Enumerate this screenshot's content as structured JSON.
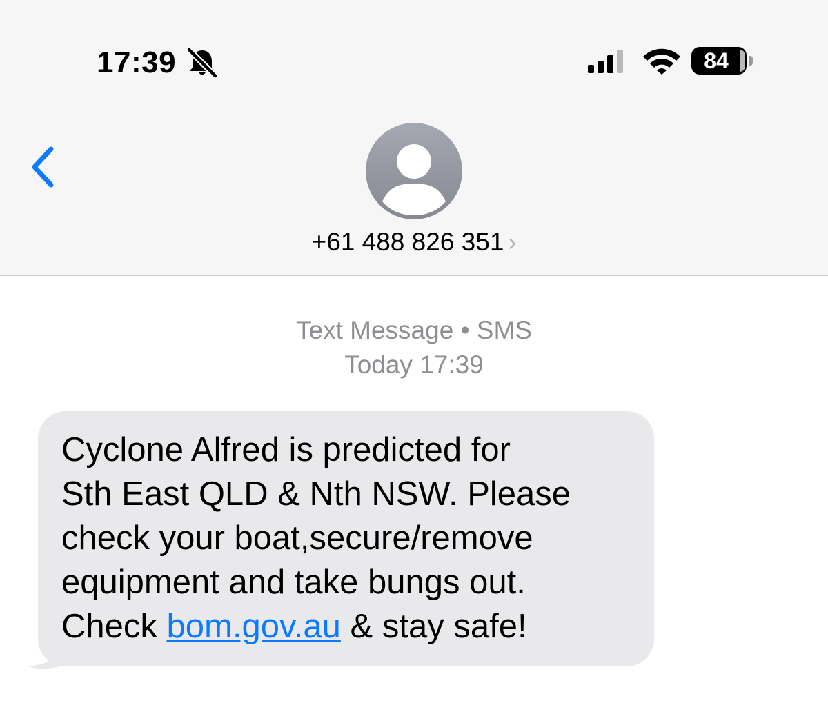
{
  "status_bar": {
    "time": "17:39",
    "battery": "84",
    "icons": [
      "bell-slash-icon",
      "cellular-signal-icon",
      "wifi-icon",
      "battery-icon"
    ]
  },
  "header": {
    "back_icon": "chevron-left-icon",
    "contact": "+61 488 826 351",
    "contact_chevron": "›",
    "accent_color": "#0a7aff"
  },
  "conversation": {
    "service": "Text Message • SMS",
    "date": "Today 17:39",
    "message": {
      "text_before_link": "Cyclone Alfred is predicted for\nSth East QLD & Nth NSW. Please\ncheck your boat,secure/remove\nequipment and take bungs out.\nCheck ",
      "link": "bom.gov.au",
      "text_after_link": " & stay safe!",
      "bubble_color": "#e9e9eb"
    }
  }
}
